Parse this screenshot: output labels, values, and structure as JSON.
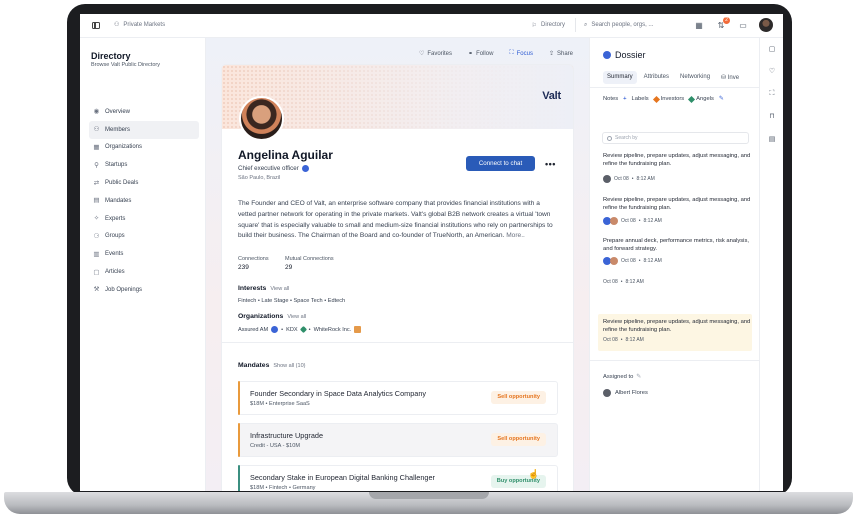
{
  "topbar": {
    "breadcrumb": "Private Markets",
    "directory_label": "Directory",
    "search_placeholder": "Search people, orgs, ...",
    "notif_count": "2"
  },
  "leftnav": {
    "title": "Directory",
    "subtitle": "Browse Valt Public Directory",
    "items": [
      {
        "label": "Overview",
        "icon": "rss-icon"
      },
      {
        "label": "Members",
        "icon": "members-icon"
      },
      {
        "label": "Organizations",
        "icon": "organizations-icon"
      },
      {
        "label": "Startups",
        "icon": "startups-icon"
      },
      {
        "label": "Public Deals",
        "icon": "deals-icon"
      },
      {
        "label": "Mandates",
        "icon": "mandates-icon"
      },
      {
        "label": "Experts",
        "icon": "experts-icon"
      },
      {
        "label": "Groups",
        "icon": "groups-icon"
      },
      {
        "label": "Events",
        "icon": "events-icon"
      },
      {
        "label": "Articles",
        "icon": "articles-icon"
      },
      {
        "label": "Job Openings",
        "icon": "jobs-icon"
      }
    ]
  },
  "actions": {
    "favorites": "Favorites",
    "follow": "Follow",
    "focus": "Focus",
    "share": "Share"
  },
  "profile": {
    "brand": "Valt",
    "name": "Angelina Aguilar",
    "title": "Chief executive officer",
    "location": "São Paulo, Brazil",
    "connect_label": "Connect to chat",
    "more_label": "•••",
    "bio": "The Founder and CEO of Valt, an enterprise software company that  provides financial institutions with a vetted partner network for  operating in the private markets. Valt's global B2B network creates a  virtual 'town square' that is especially valuable to small and  medium-size financial institutions who rely on partnerships to build  their business.  The Chairman of the Board and co-founder of TrueNorth, an American.",
    "bio_more": "More..",
    "connections_label": "Connections",
    "connections_value": "239",
    "mutual_label": "Mutual Connections",
    "mutual_value": "29",
    "interests_title": "Interests",
    "interests_link": "View all",
    "interests": "Fintech • Late Stage • Space Tech • Edtech",
    "orgs_title": "Organizations",
    "orgs_link": "View all",
    "orgs": [
      "Assured AM",
      "KDX",
      "WhiteRock Inc."
    ],
    "orgs_sep": "•"
  },
  "mandates": {
    "title": "Mandates",
    "link": "Show all (10)",
    "items": [
      {
        "title": "Founder Secondary in Space Data Analytics Company",
        "sub": "$18M • Enterprise SaaS",
        "tag": "Sell opportunity",
        "tag_color": "#e5751f",
        "tag_bg": "#fdf1e4",
        "bar": "#e99a3c"
      },
      {
        "title": "Infrastructure Upgrade",
        "sub": "Credit - USA - $10M",
        "tag": "Sell opportunity",
        "tag_color": "#e5751f",
        "tag_bg": "#fdf1e4",
        "bar": "#e99a3c"
      },
      {
        "title": "Secondary Stake in European Digital Banking Challenger",
        "sub": "$18M • Fintech • Germany",
        "tag": "Buy opportunity",
        "tag_color": "#2f8f6a",
        "tag_bg": "#e6f4ee",
        "bar": "#3b8f80"
      }
    ]
  },
  "dossier": {
    "title": "Dossier",
    "tabs": [
      "Summary",
      "Attributes",
      "Networking",
      "Inve"
    ],
    "notes_label": "Notes",
    "labels_label": "Labels",
    "tags": [
      {
        "label": "Investors",
        "color": "#e5751f"
      },
      {
        "label": "Angels",
        "color": "#2f8f6a"
      }
    ],
    "search_placeholder": "Search by",
    "notes": [
      {
        "text": "Review pipeline, prepare updates, adjust messaging, and refine the fundraising plan.",
        "date": "Oct 08",
        "time": "8:12 AM"
      },
      {
        "text": "Review pipeline, prepare updates, adjust messaging, and refine the fundraising plan.",
        "date": "Oct 08",
        "time": "8:12 AM"
      },
      {
        "text": "Prepare annual deck, performance metrics, risk analysis, and forward strategy.",
        "date": "Oct 08",
        "time": "8:12 AM"
      },
      {
        "text": "",
        "date": "Oct 08",
        "time": "8:12 AM"
      },
      {
        "text": "Review pipeline, prepare updates, adjust messaging, and refine the fundraising plan.",
        "date": "Oct 08",
        "time": "8:12 AM"
      }
    ],
    "assigned_label": "Assigned to",
    "assignee": "Albert Flores"
  }
}
